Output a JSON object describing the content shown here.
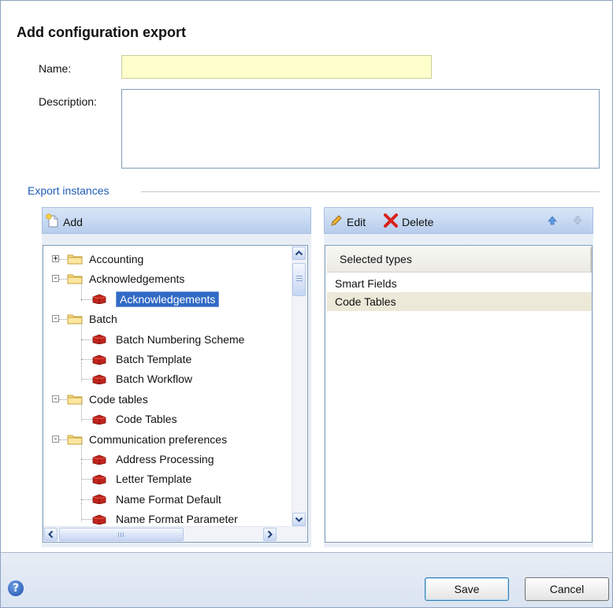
{
  "dialog": {
    "title": "Add configuration export",
    "name_label": "Name:",
    "name_value": "",
    "description_label": "Description:",
    "description_value": "",
    "section_label": "Export instances"
  },
  "left_toolbar": {
    "add_label": "Add"
  },
  "right_toolbar": {
    "edit_label": "Edit",
    "delete_label": "Delete"
  },
  "tree": {
    "nodes": [
      {
        "label": "Accounting",
        "level": 0,
        "type": "folder",
        "expander": "+"
      },
      {
        "label": "Acknowledgements",
        "level": 0,
        "type": "folder",
        "expander": "-"
      },
      {
        "label": "Acknowledgements",
        "level": 1,
        "type": "item",
        "selected": true
      },
      {
        "label": "Batch",
        "level": 0,
        "type": "folder",
        "expander": "-"
      },
      {
        "label": "Batch Numbering Scheme",
        "level": 1,
        "type": "item"
      },
      {
        "label": "Batch Template",
        "level": 1,
        "type": "item"
      },
      {
        "label": "Batch Workflow",
        "level": 1,
        "type": "item"
      },
      {
        "label": "Code tables",
        "level": 0,
        "type": "folder",
        "expander": "-"
      },
      {
        "label": "Code Tables",
        "level": 1,
        "type": "item"
      },
      {
        "label": "Communication preferences",
        "level": 0,
        "type": "folder",
        "expander": "-"
      },
      {
        "label": "Address Processing",
        "level": 1,
        "type": "item"
      },
      {
        "label": "Letter Template",
        "level": 1,
        "type": "item"
      },
      {
        "label": "Name Format Default",
        "level": 1,
        "type": "item"
      },
      {
        "label": "Name Format Parameter",
        "level": 1,
        "type": "item"
      }
    ]
  },
  "selected_types": {
    "header": "Selected types",
    "rows": [
      "Smart Fields",
      "Code Tables"
    ],
    "highlighted_row": 1
  },
  "footer": {
    "save_label": "Save",
    "cancel_label": "Cancel"
  },
  "colors": {
    "accent": "#1f5bb8",
    "selection": "#316ac5",
    "name_field_bg": "#ffffcc",
    "row_highlight": "#ece9d8"
  },
  "icons": {
    "add": "new-document-icon",
    "edit": "pencil-icon",
    "delete": "red-x-icon",
    "move_up": "arrow-up-icon",
    "move_down": "arrow-down-icon",
    "folder": "folder-icon",
    "item": "red-box-icon",
    "help": "help-icon"
  }
}
